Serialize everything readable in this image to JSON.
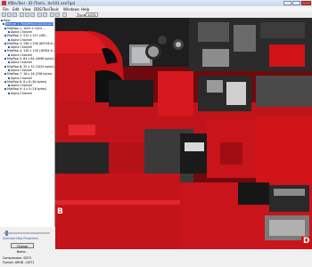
{
  "window": {
    "title": "KfBruTool - [D:\\Train\\...\\br101.aceTga]"
  },
  "menu": [
    "File",
    "Edit",
    "View",
    "DDS/Tool",
    "Tools",
    "Windows",
    "Help"
  ],
  "toolbar": {
    "zoom_label": "Zoom:",
    "zoom_value": "100%"
  },
  "tree": [
    {
      "label": "Root",
      "selected": false,
      "indent": 0
    },
    {
      "label": "Texture 1: RailVehicle1024x1024",
      "selected": true,
      "indent": 2
    },
    {
      "label": "MipMap 1: 1024 x 1024 ...",
      "selected": false,
      "indent": 4
    },
    {
      "label": "Alpha Channel",
      "selected": false,
      "indent": 8
    },
    {
      "label": "MipMap 2: 512 x 512 (262...",
      "selected": false,
      "indent": 4
    },
    {
      "label": "Alpha Channel",
      "selected": false,
      "indent": 8
    },
    {
      "label": "MipMap 3: 256 x 256 (65536 b...",
      "selected": false,
      "indent": 4
    },
    {
      "label": "Alpha Channel",
      "selected": false,
      "indent": 8
    },
    {
      "label": "MipMap 4: 128 x 128 (16384 b...",
      "selected": false,
      "indent": 4
    },
    {
      "label": "Alpha Channel",
      "selected": false,
      "indent": 8
    },
    {
      "label": "MipMap 5: 64 x 64 (4096 bytes)",
      "selected": false,
      "indent": 4
    },
    {
      "label": "Alpha Channel",
      "selected": false,
      "indent": 8
    },
    {
      "label": "MipMap 6: 32 x 32 (1024 bytes)",
      "selected": false,
      "indent": 4
    },
    {
      "label": "Alpha Channel",
      "selected": false,
      "indent": 8
    },
    {
      "label": "MipMap 7: 16 x 16 (256 bytes)",
      "selected": false,
      "indent": 4
    },
    {
      "label": "Alpha Channel",
      "selected": false,
      "indent": 8
    },
    {
      "label": "MipMap 8: 8 x 8 (64 bytes)",
      "selected": false,
      "indent": 4
    },
    {
      "label": "Alpha Channel",
      "selected": false,
      "indent": 8
    },
    {
      "label": "MipMap 9: 4 x 4 (16 bytes)",
      "selected": false,
      "indent": 4
    },
    {
      "label": "Alpha Channel",
      "selected": false,
      "indent": 8
    }
  ],
  "properties": {
    "heading": "Selected Map Properties",
    "change_button": "Change Name...",
    "compression": "Compression: DXT1",
    "format": "Format: ARGB - DXT1"
  },
  "viewer": {
    "tag_left": "B",
    "tag_right": "D"
  },
  "colors": {
    "accent": "#d01010",
    "dark": "#1a1a1a",
    "selection": "#3b6fd2"
  }
}
